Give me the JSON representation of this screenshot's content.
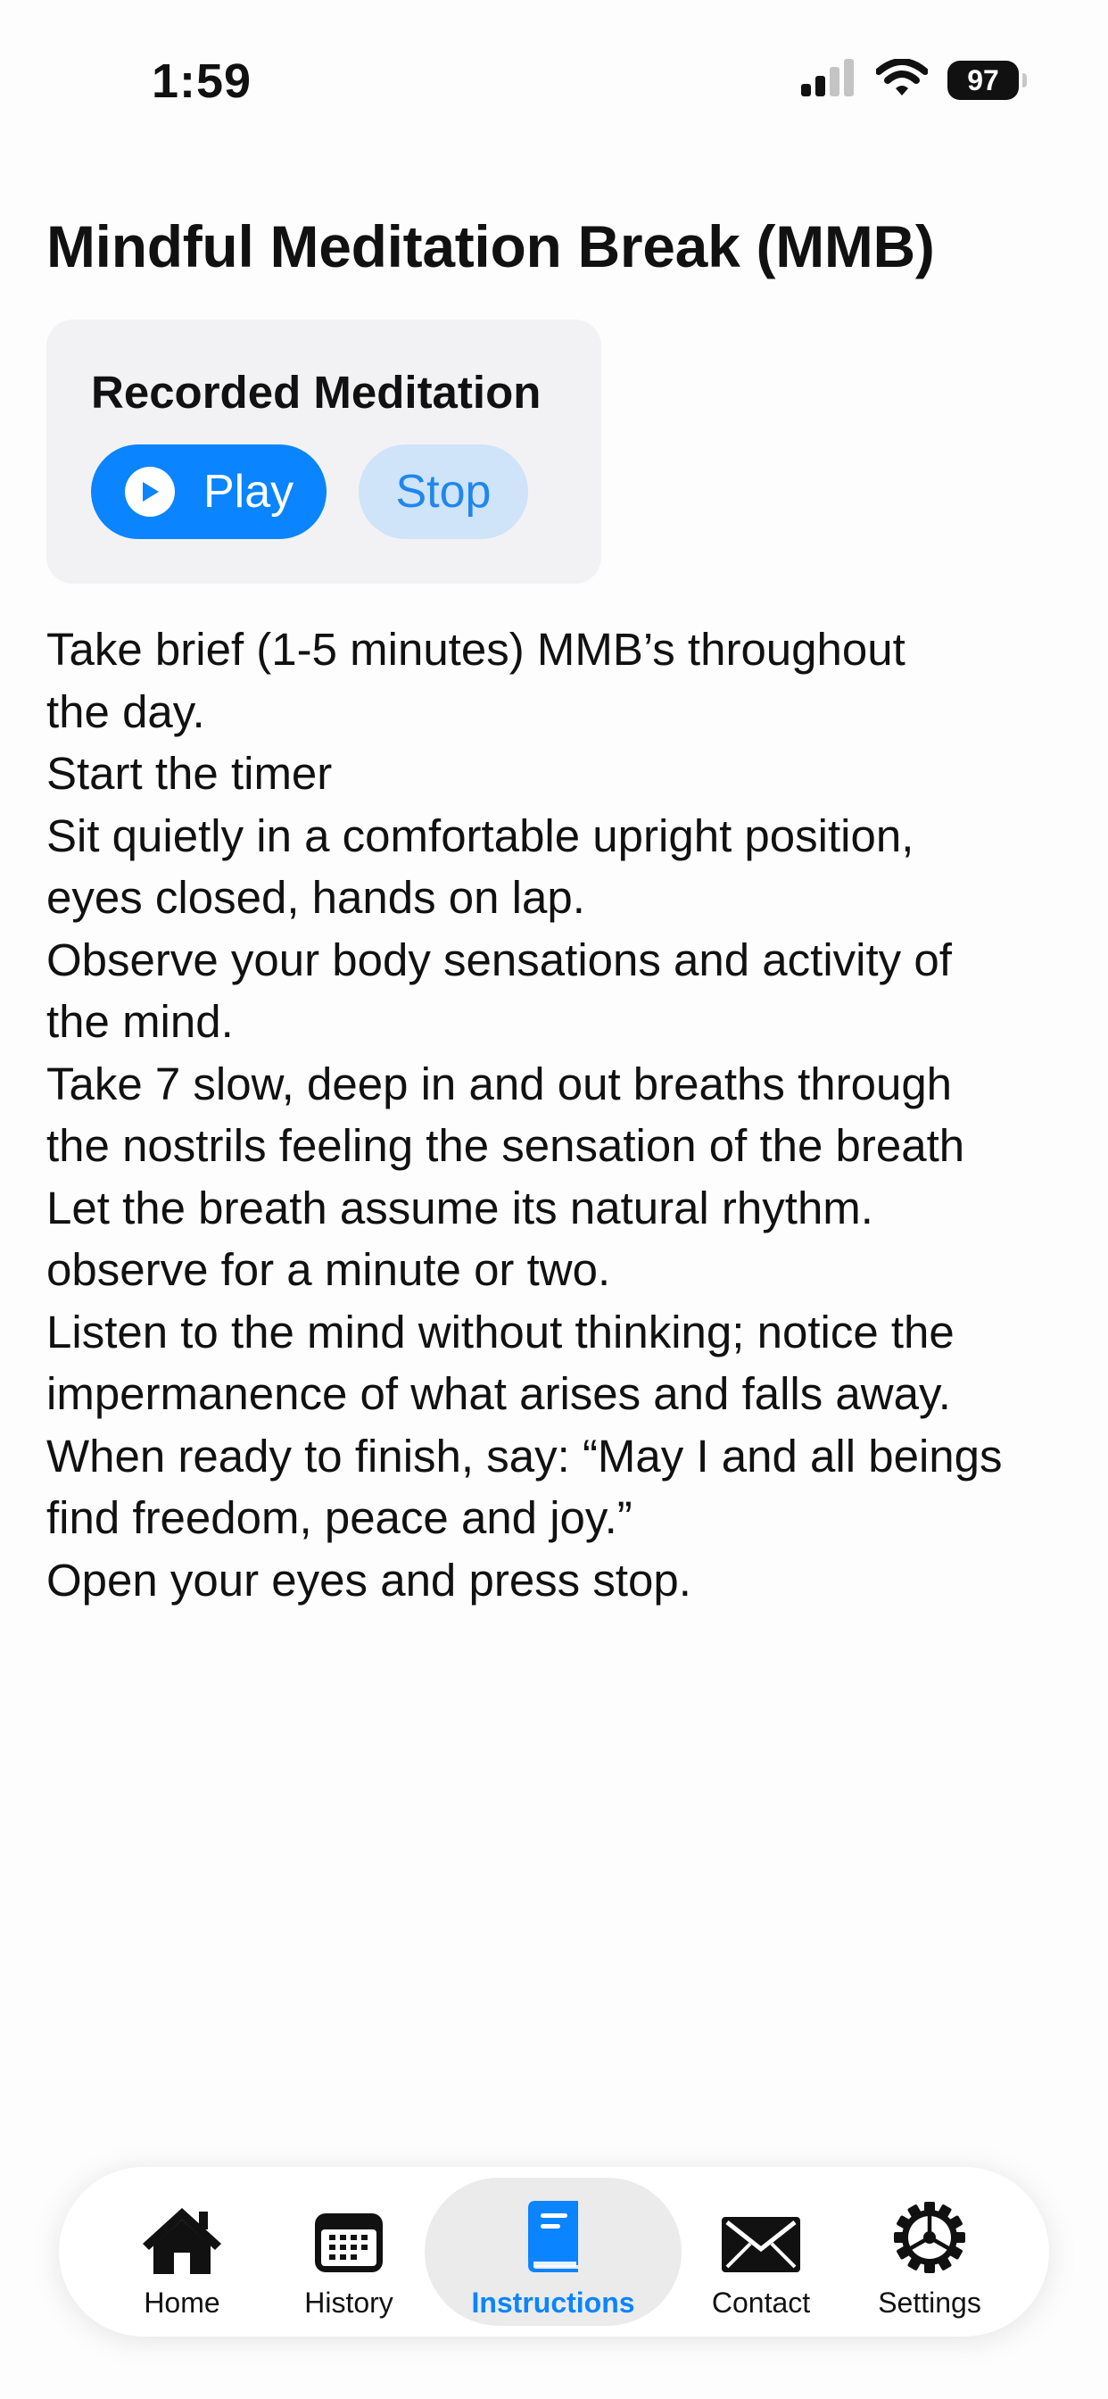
{
  "status_bar": {
    "time": "1:59",
    "battery": "97",
    "signal_icon": "signal-icon",
    "wifi_icon": "wifi-icon"
  },
  "page": {
    "title": "Mindful Meditation Break (MMB)"
  },
  "recorded_meditation": {
    "title": "Recorded Meditation",
    "play_label": "Play",
    "stop_label": "Stop",
    "play_icon": "play-circle-icon"
  },
  "instructions": {
    "lines": [
      "Take brief (1-5 minutes) MMB’s throughout",
      "the day.",
      "Start the timer",
      "Sit quietly in a comfortable upright position,",
      "eyes closed, hands on lap.",
      "Observe your body sensations and activity of",
      "the mind.",
      "Take 7 slow, deep in and out breaths through",
      "the nostrils feeling the sensation of the breath",
      "Let the breath assume its natural rhythm.",
      "observe for a minute or two.",
      "Listen to the mind without thinking; notice the",
      "impermanence of what arises and falls away.",
      "When ready to finish, say: “May I and all beings",
      "find freedom, peace and joy.”",
      "Open your eyes and press stop."
    ]
  },
  "tab_bar": {
    "active": "Instructions",
    "tabs": [
      {
        "label": "Home",
        "icon": "house-icon"
      },
      {
        "label": "History",
        "icon": "calendar-icon"
      },
      {
        "label": "Instructions",
        "icon": "book-icon"
      },
      {
        "label": "Contact",
        "icon": "envelope-icon"
      },
      {
        "label": "Settings",
        "icon": "gear-icon"
      }
    ]
  },
  "colors": {
    "accent": "#0a84ff",
    "stop_button_bg": "#cfe3f9",
    "card_bg": "#f2f2f4",
    "active_tab_bg": "#ebebeb"
  }
}
